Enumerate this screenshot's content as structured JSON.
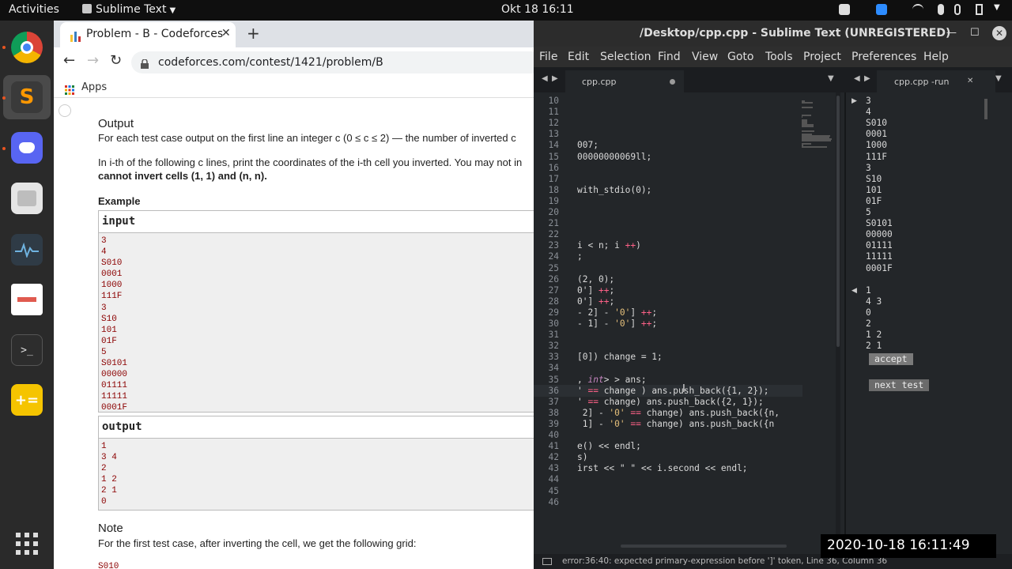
{
  "topbar": {
    "activities": "Activities",
    "app_menu": "Sublime Text",
    "clock": "Okt 18  16:11"
  },
  "dock": {
    "apps": [
      "chrome-icon",
      "sublime-icon",
      "discord-icon",
      "files-icon",
      "system-monitor-icon",
      "text-editor-icon",
      "terminal-icon",
      "calculator-icon",
      "show-apps-icon"
    ]
  },
  "chrome": {
    "tab_title": "Problem - B - Codeforces",
    "tab_close": "✕",
    "new_tab": "+",
    "url": "codeforces.com/contest/1421/problem/B",
    "bookmarks_apps": "Apps",
    "page": {
      "output_title": "Output",
      "output_desc": "For each test case output on the first line an integer c (0 ≤ c ≤ 2) — the number of inverted c",
      "invert_desc": "In i-th of the following c lines, print the coordinates of the i-th cell you inverted. You may not in",
      "invert_desc_bold": "cannot invert cells (1, 1) and (n, n).",
      "example_title": "Example",
      "input_header": "input",
      "input_lines": [
        "3",
        "4",
        "S010",
        "0001",
        "1000",
        "111F",
        "3",
        "S10",
        "101",
        "01F",
        "5",
        "S0101",
        "00000",
        "01111",
        "11111",
        "0001F"
      ],
      "output_header": "output",
      "output_lines": [
        "1",
        "3 4",
        "2",
        "1 2",
        "2 1",
        "0"
      ],
      "note_title": "Note",
      "note_desc": "For the first test case, after inverting the cell, we get the following grid:",
      "note_cut": "S010"
    }
  },
  "sublime": {
    "title": "~/Desktop/cpp.cpp — Sublime Text (UNREGISTERED)",
    "title_visible": "/Desktop/cpp.cpp - Sublime Text (UNREGISTERED)",
    "menu": [
      "File",
      "Edit",
      "Selection",
      "Find",
      "View",
      "Goto",
      "Tools",
      "Project",
      "Preferences",
      "Help"
    ],
    "left_tab": "cpp.cpp",
    "right_tab": "cpp.cpp -run",
    "tab_close": "✕",
    "line_numbers": [
      "10",
      "11",
      "12",
      "13",
      "14",
      "15",
      "16",
      "17",
      "18",
      "19",
      "20",
      "21",
      "22",
      "23",
      "24",
      "25",
      "26",
      "27",
      "28",
      "29",
      "30",
      "31",
      "32",
      "33",
      "34",
      "35",
      "36",
      "37",
      "38",
      "39",
      "40",
      "41",
      "42",
      "43",
      "44",
      "45",
      "46"
    ],
    "code_lines": [
      "",
      "",
      "",
      "",
      "007;",
      "00000000069ll;",
      "",
      "",
      "with_stdio(0);",
      "",
      "",
      "",
      "",
      "i < n; i ++)",
      ";",
      "",
      "(2, 0);",
      "0'] ++;",
      "0'] ++;",
      "- 2] - '0'] ++;",
      "- 1] - '0'] ++;",
      "",
      "",
      "[0]) change = 1;",
      "",
      ", int> > ans;",
      "' == change ) ans.push_back({1, 2});",
      "' == change) ans.push_back({2, 1});",
      " 2] - '0' == change) ans.push_back({n,",
      " 1] - '0' == change) ans.push_back({n",
      "",
      "e() << endl;",
      "s)",
      "irst << \" \" << i.second << endl;",
      "",
      "",
      ""
    ],
    "output_input": [
      "3",
      "4",
      "S010",
      "0001",
      "1000",
      "111F",
      "3",
      "S10",
      "101",
      "01F",
      "5",
      "S0101",
      "00000",
      "01111",
      "11111",
      "0001F"
    ],
    "output_result": [
      "1",
      "4 3",
      "0",
      "2",
      "1 2",
      "2 1"
    ],
    "accept_label": "accept",
    "next_test_label": "next test",
    "status": "error:36:40: expected primary-expression before ']' token, Line 36, Column 36"
  },
  "overlay": {
    "recording_time": "2020-10-18  16:11:49"
  },
  "colors": {
    "topbar_bg": "#0f0f0f",
    "dock_bg": "#2a2a2a",
    "sublime_bg": "#232629",
    "io_text": "#8b0000",
    "ubuntu_accent": "#e95420"
  }
}
